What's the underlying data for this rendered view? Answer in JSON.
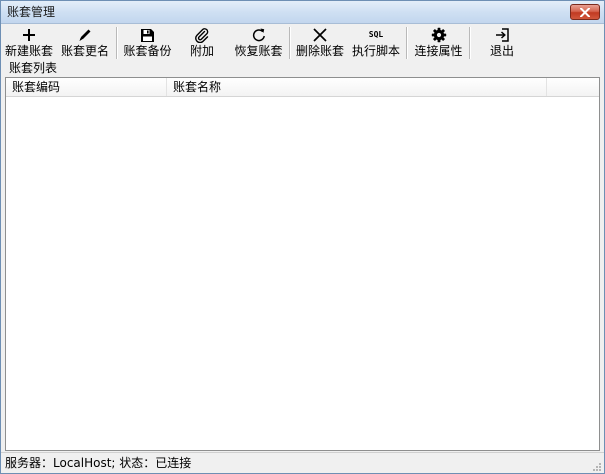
{
  "window": {
    "title": "账套管理"
  },
  "toolbar": {
    "items": [
      {
        "label": "新建账套",
        "icon": "plus-icon"
      },
      {
        "label": "账套更名",
        "icon": "pencil-icon"
      },
      {
        "label": "账套备份",
        "icon": "save-icon"
      },
      {
        "label": "附加",
        "icon": "paperclip-icon"
      },
      {
        "label": "恢复账套",
        "icon": "refresh-icon"
      },
      {
        "label": "删除账套",
        "icon": "close-icon"
      },
      {
        "label": "执行脚本",
        "icon": "sql-icon",
        "icon_text": "SQL"
      },
      {
        "label": "连接属性",
        "icon": "gear-icon"
      },
      {
        "label": "退出",
        "icon": "exit-icon"
      }
    ]
  },
  "list": {
    "group_label": "账套列表",
    "columns": [
      "账套编码",
      "账套名称"
    ],
    "rows": []
  },
  "status": {
    "text": "服务器：LocalHost; 状态：已连接"
  },
  "colors": {
    "close_button": "#c13a22",
    "titlebar": "#cfe0f3"
  }
}
